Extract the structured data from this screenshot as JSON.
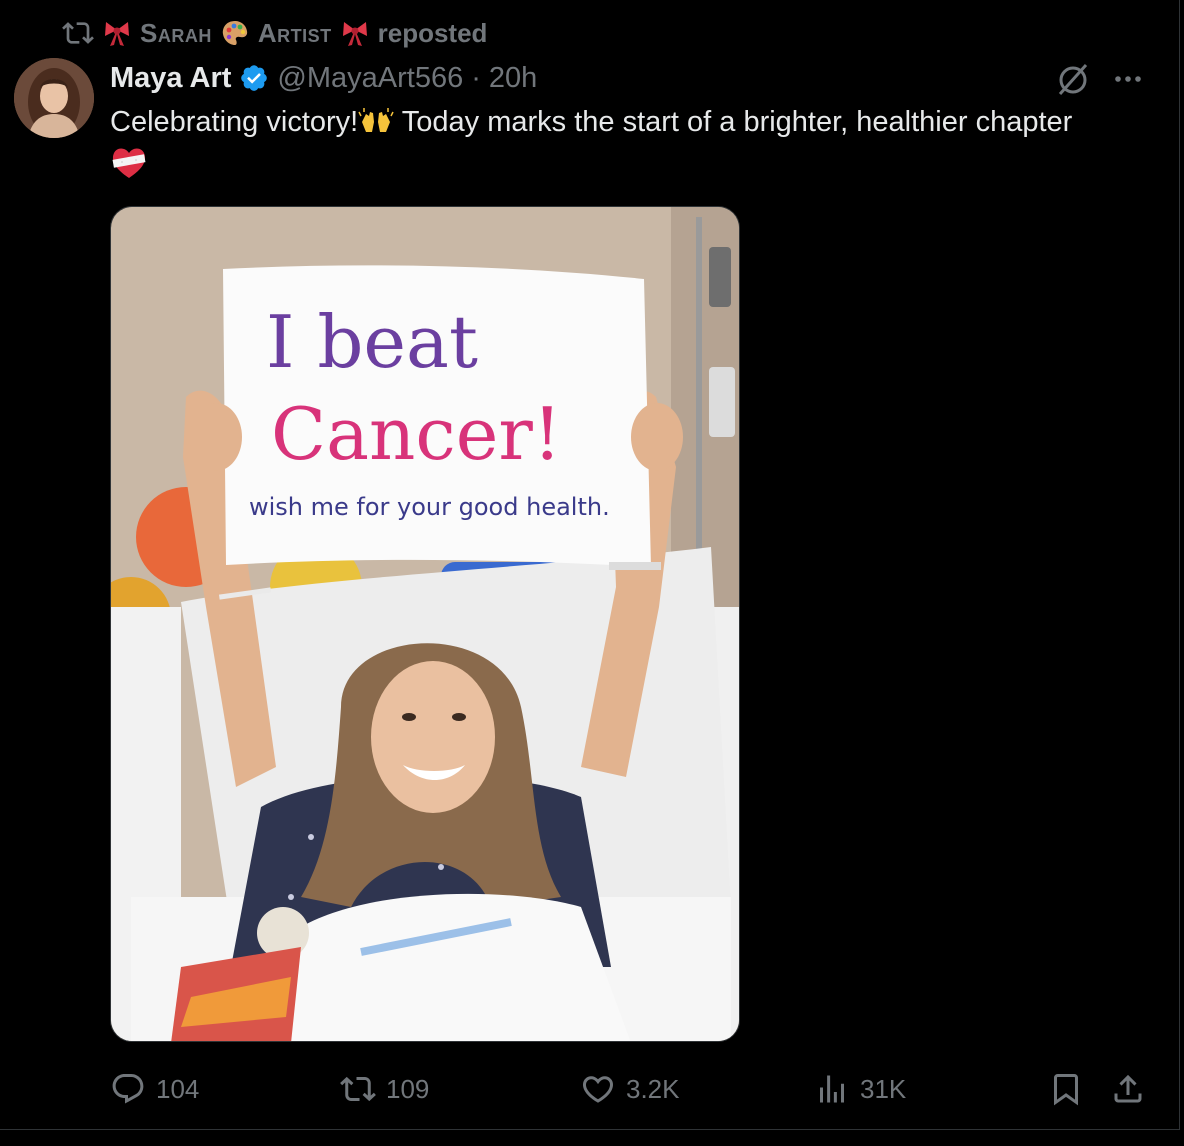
{
  "repost": {
    "user_a": "Sarah",
    "user_b": "Artist",
    "suffix": "reposted"
  },
  "author": {
    "name": "Maya Art",
    "handle": "@MayaArt566",
    "separator": "·",
    "time": "20h"
  },
  "post": {
    "text_line1": "Celebrating victory!",
    "text_line1b": " Today marks the start of a brighter, healthier chapter"
  },
  "media": {
    "sign_line1": "I beat",
    "sign_line2": "Cancer!",
    "sign_line3": "wish me for your good health."
  },
  "actions": {
    "replies": "104",
    "reposts": "109",
    "likes": "3.2K",
    "views": "31K"
  },
  "colors": {
    "background": "#000000",
    "text": "#e7e9ea",
    "muted": "#71767b",
    "verified": "#1d9bf0"
  },
  "icons": [
    "repost-icon",
    "bow-emoji",
    "palette-emoji",
    "verified-badge-icon",
    "grok-icon",
    "more-icon",
    "raising-hands-emoji",
    "mending-heart-emoji",
    "reply-icon",
    "like-icon",
    "views-icon",
    "bookmark-icon",
    "share-icon"
  ]
}
